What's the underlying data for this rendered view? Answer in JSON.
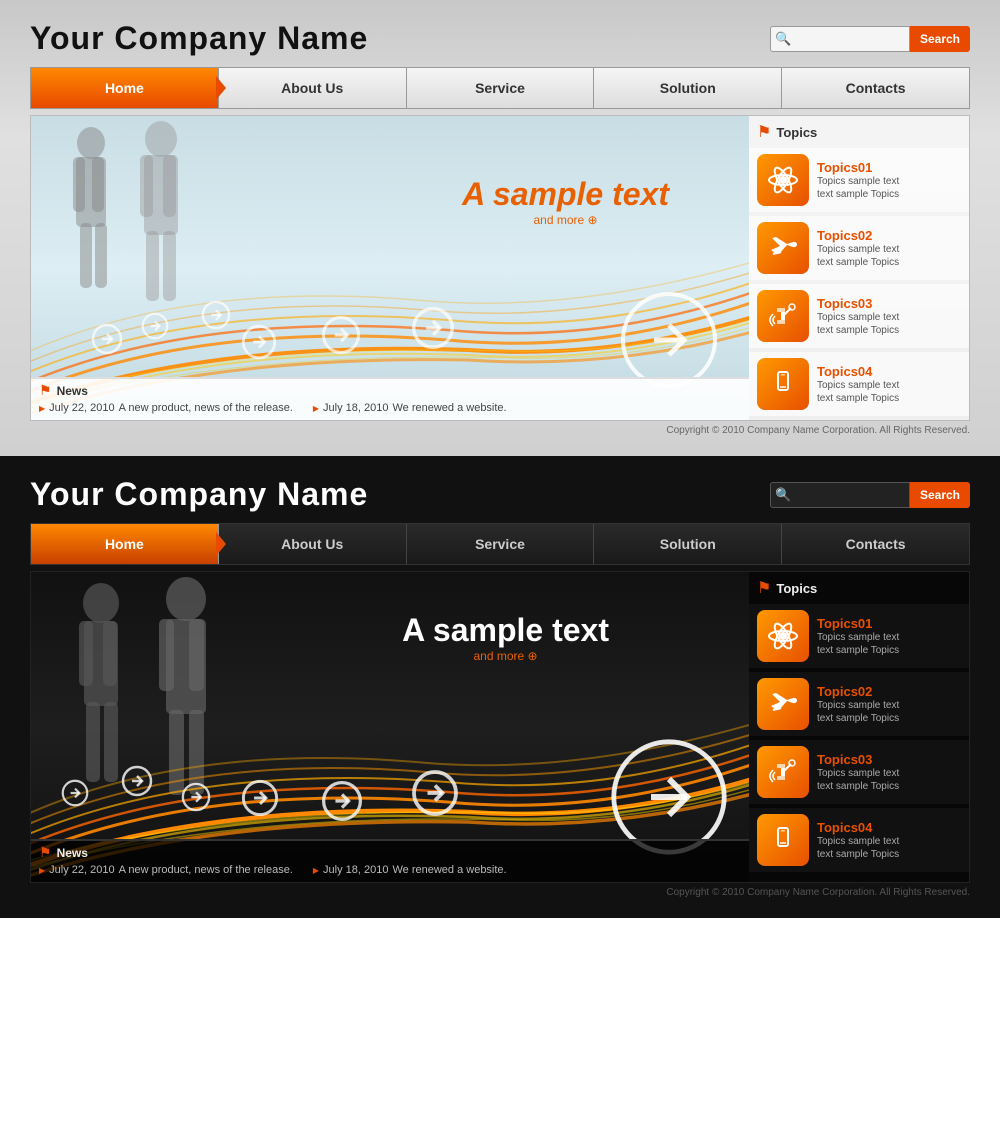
{
  "light": {
    "company_name": "Your Company Name",
    "search": {
      "placeholder": "",
      "button": "Search"
    },
    "nav": {
      "items": [
        {
          "label": "Home",
          "active": true
        },
        {
          "label": "About Us",
          "active": false
        },
        {
          "label": "Service",
          "active": false
        },
        {
          "label": "Solution",
          "active": false
        },
        {
          "label": "Contacts",
          "active": false
        }
      ]
    },
    "hero": {
      "title": "A sample text",
      "subtitle": "and more ⊕"
    },
    "topics_header": "Topics",
    "topics": [
      {
        "id": "01",
        "title": "Topics01",
        "desc": "Topics sample text\ntext sample Topics",
        "icon": "⚛"
      },
      {
        "id": "02",
        "title": "Topics02",
        "desc": "Topics sample text\ntext sample Topics",
        "icon": "✈"
      },
      {
        "id": "03",
        "title": "Topics03",
        "desc": "Topics sample text\ntext sample Topics",
        "icon": "📡"
      },
      {
        "id": "04",
        "title": "Topics04",
        "desc": "Topics sample text\ntext sample Topics",
        "icon": "📱"
      }
    ],
    "news_label": "News",
    "news": [
      {
        "date": "July 22, 2010",
        "text": "A new product, news of the release."
      },
      {
        "date": "July 18, 2010",
        "text": "We renewed a website."
      }
    ],
    "copyright": "Copyright © 2010 Company Name Corporation. All Rights Reserved."
  },
  "dark": {
    "company_name": "Your Company Name",
    "search": {
      "placeholder": "",
      "button": "Search"
    },
    "nav": {
      "items": [
        {
          "label": "Home",
          "active": true
        },
        {
          "label": "About Us",
          "active": false
        },
        {
          "label": "Service",
          "active": false
        },
        {
          "label": "Solution",
          "active": false
        },
        {
          "label": "Contacts",
          "active": false
        }
      ]
    },
    "hero": {
      "title": "A sample text",
      "subtitle": "and more ⊕"
    },
    "topics_header": "Topics",
    "topics": [
      {
        "id": "01",
        "title": "Topics01",
        "desc": "Topics sample text\ntext sample Topics",
        "icon": "⚛"
      },
      {
        "id": "02",
        "title": "Topics02",
        "desc": "Topics sample text\ntext sample Topics",
        "icon": "✈"
      },
      {
        "id": "03",
        "title": "Topics03",
        "desc": "Topics sample text\ntext sample Topics",
        "icon": "📡"
      },
      {
        "id": "04",
        "title": "Topics04",
        "desc": "Topics sample text\ntext sample Topics",
        "icon": "📱"
      }
    ],
    "news_label": "News",
    "news": [
      {
        "date": "July 22, 2010",
        "text": "A new product, news of the release."
      },
      {
        "date": "July 18, 2010",
        "text": "We renewed a website."
      }
    ],
    "copyright": "Copyright © 2010 Company Name Corporation. All Rights Reserved."
  }
}
